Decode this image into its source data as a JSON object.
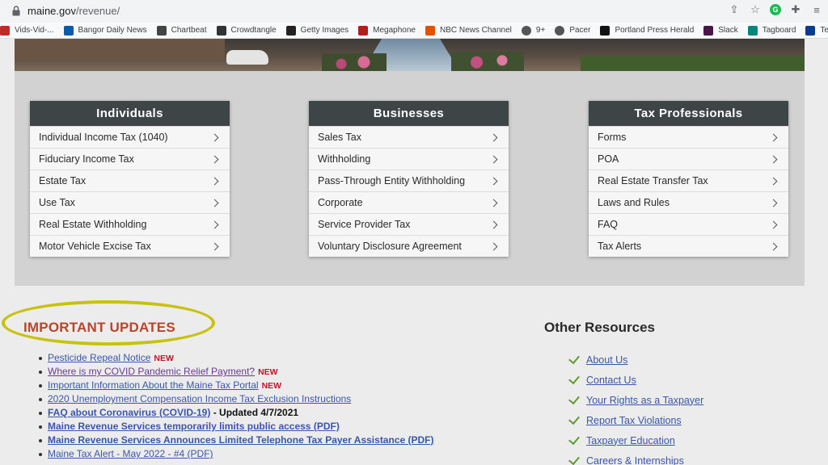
{
  "browser": {
    "url_domain": "maine.gov",
    "url_path": "/revenue/",
    "bookmarks": [
      {
        "label": "Vids-Vid-...",
        "icon": "video-icon",
        "color": "#c62828"
      },
      {
        "label": "Bangor Daily News",
        "icon": "bdn-icon",
        "color": "#0b5ca8"
      },
      {
        "label": "Chartbeat",
        "icon": "chartbeat-icon",
        "color": "#444"
      },
      {
        "label": "Crowdtangle",
        "icon": "crowdtangle-icon",
        "color": "#333"
      },
      {
        "label": "Getty Images",
        "icon": "getty-icon",
        "color": "#222"
      },
      {
        "label": "Megaphone",
        "icon": "megaphone-icon",
        "color": "#b71c1c"
      },
      {
        "label": "NBC News Channel",
        "icon": "nbc-peacock-icon",
        "color": "#e65100"
      },
      {
        "label": "9+",
        "icon": "globe-icon",
        "color": "#555"
      },
      {
        "label": "Pacer",
        "icon": "globe-icon",
        "color": "#555"
      },
      {
        "label": "Portland Press Herald",
        "icon": "pph-icon",
        "color": "#111"
      },
      {
        "label": "Slack",
        "icon": "slack-icon",
        "color": "#4a154b"
      },
      {
        "label": "Tagboard",
        "icon": "tagboard-icon",
        "color": "#00897b"
      },
      {
        "label": "Tegna Okta",
        "icon": "okta-icon",
        "color": "#0d3b8e"
      }
    ]
  },
  "cards": [
    {
      "title": "Individuals",
      "items": [
        "Individual Income Tax (1040)",
        "Fiduciary Income Tax",
        "Estate Tax",
        "Use Tax",
        "Real Estate Withholding",
        "Motor Vehicle Excise Tax"
      ]
    },
    {
      "title": "Businesses",
      "items": [
        "Sales Tax",
        "Withholding",
        "Pass-Through Entity Withholding",
        "Corporate",
        "Service Provider Tax",
        "Voluntary Disclosure Agreement"
      ]
    },
    {
      "title": "Tax Professionals",
      "items": [
        "Forms",
        "POA",
        "Real Estate Transfer Tax",
        "Laws and Rules",
        "FAQ",
        "Tax Alerts"
      ]
    }
  ],
  "updates": {
    "title": "IMPORTANT UPDATES",
    "new_label": "NEW",
    "items": [
      {
        "text": "Pesticide Repeal Notice",
        "new": true
      },
      {
        "text": "Where is my COVID Pandemic Relief Payment?",
        "new": true,
        "visited": true
      },
      {
        "text": "Important Information About the Maine Tax Portal",
        "new": true
      },
      {
        "text": "2020 Unemployment Compensation Income Tax Exclusion Instructions"
      },
      {
        "text": "FAQ about Coronavirus (COVID-19)",
        "bold": true,
        "suffix": " - Updated 4/7/2021"
      },
      {
        "text": "Maine Revenue Services temporarily limits public access (PDF)",
        "bold": true
      },
      {
        "text": "Maine Revenue Services Announces Limited Telephone Tax Payer Assistance (PDF)",
        "bold": true
      },
      {
        "text": "Maine Tax Alert - May 2022 - #4 (PDF)"
      }
    ]
  },
  "resources": {
    "title": "Other Resources",
    "items": [
      "About Us",
      "Contact Us",
      "Your Rights as a Taxpayer",
      "Report Tax Violations",
      "Taxpayer Education",
      "Careers & Internships"
    ]
  }
}
